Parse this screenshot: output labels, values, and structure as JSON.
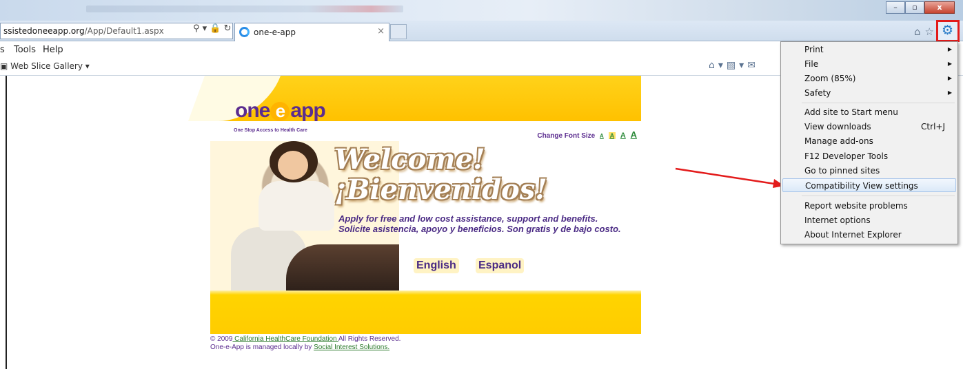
{
  "browser": {
    "address": {
      "prefix": "ssistedoneeapp.org",
      "path": "/App/Default1.aspx"
    },
    "tab": {
      "title": "one-e-app",
      "close": "×"
    },
    "window_buttons": {
      "minimize": "–",
      "restore": "▫",
      "close": "x"
    },
    "menu": [
      "s",
      "Tools",
      "Help"
    ],
    "favorites": {
      "label": "Web Slice Gallery"
    }
  },
  "site": {
    "logo": {
      "left": "one",
      "e": "e",
      "right": "app"
    },
    "tagline": "One Stop Access to Health Care",
    "font_size": {
      "label": "Change Font Size",
      "sizes": [
        "A",
        "A",
        "A",
        "A"
      ]
    },
    "welcome": "Welcome!",
    "bienvenidos": "¡Bienvenidos!",
    "desc_en": "Apply for free and low cost assistance, support and benefits.",
    "desc_es": "Solicite asistencia, apoyo y beneficios. Son gratis y de bajo costo.",
    "lang_english": "English",
    "lang_espanol": "Espanol"
  },
  "footer": {
    "copyright_pre": "© 2009",
    "chcf": " California HealthCare Foundation ",
    "copyright_post": "All Rights Reserved.",
    "managed_pre": "One-e-App is managed locally by ",
    "sis": "Social Interest Solutions."
  },
  "tools_menu": {
    "items": [
      {
        "label": "Print",
        "submenu": true
      },
      {
        "label": "File",
        "submenu": true
      },
      {
        "label": "Zoom (85%)",
        "submenu": true
      },
      {
        "label": "Safety",
        "submenu": true
      },
      {
        "label": "Add site to Start menu"
      },
      {
        "label": "View downloads",
        "shortcut": "Ctrl+J"
      },
      {
        "label": "Manage add-ons"
      },
      {
        "label": "F12 Developer Tools"
      },
      {
        "label": "Go to pinned sites"
      },
      {
        "label": "Compatibility View settings",
        "highlighted": true
      },
      {
        "label": "Report website problems"
      },
      {
        "label": "Internet options"
      },
      {
        "label": "About Internet Explorer"
      }
    ]
  },
  "colors": {
    "highlight_box": "#e31b1b",
    "arrow": "#e31b1b",
    "brand_yellow": "#ffc800",
    "brand_purple": "#5b2c8f"
  }
}
